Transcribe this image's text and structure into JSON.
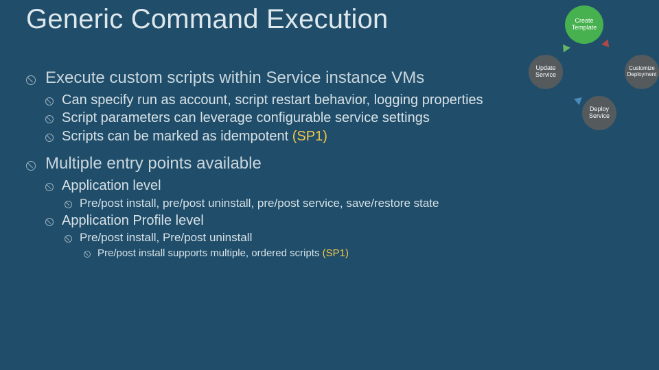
{
  "title": "Generic Command Execution",
  "flow": {
    "create": "Create\nTemplate",
    "update": "Update\nService",
    "customize": "Customize\nDeployment",
    "deploy": "Deploy\nService"
  },
  "b1a": "Execute custom scripts within Service instance VMs",
  "b1a_1": "Can specify run as account, script restart behavior, logging properties",
  "b1a_2": "Script parameters can leverage configurable service settings",
  "b1a_3_pre": "Scripts can be marked as idempotent ",
  "sp1": "(SP1)",
  "b1b": "Multiple entry points available",
  "b1b_1": "Application level",
  "b1b_1_1": "Pre/post install, pre/post uninstall, pre/post service, save/restore state",
  "b1b_2": "Application Profile level",
  "b1b_2_1": "Pre/post install, Pre/post uninstall",
  "b1b_2_1_1_pre": "Pre/post install supports multiple, ordered scripts "
}
